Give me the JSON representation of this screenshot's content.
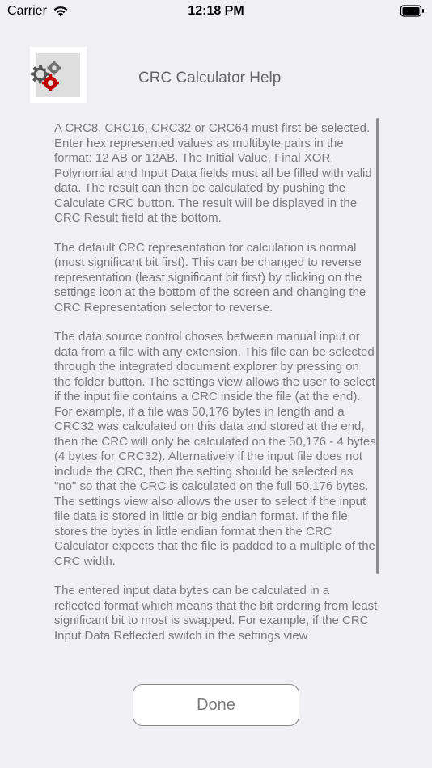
{
  "status_bar": {
    "carrier": "Carrier",
    "time": "12:18 PM",
    "icons": [
      "wifi-icon",
      "battery-icon"
    ]
  },
  "header": {
    "app_icon": "gears-icon",
    "title": "CRC Calculator Help"
  },
  "help": {
    "paragraphs": [
      "A CRC8, CRC16, CRC32 or CRC64 must first be selected. Enter hex represented values as multibyte pairs in the format: 12 AB or 12AB. The Initial Value, Final XOR, Polynomial and Input Data fields must all be filled with valid data. The result can then be calculated by pushing the Calculate CRC button. The result will be displayed in the CRC Result field at the bottom.",
      "The default CRC representation for calculation is normal (most significant bit first). This can be changed to reverse representation (least significant bit first) by clicking on the settings icon at the bottom of the screen and changing the CRC Representation selector to reverse.",
      "The data source control choses between manual input or data from a file with any extension. This file can be selected through the integrated document explorer by pressing on the folder button. The settings view allows the user to select if the input file contains a CRC inside the file (at the end). For example, if a file was 50,176 bytes in length and a CRC32 was calculated on this data and stored at the end, then the CRC will only be calculated on the 50,176 - 4 bytes (4 bytes for CRC32). Alternatively if the input file does not include the CRC, then the setting should be selected as \"no\" so that the CRC is calculated on the full 50,176 bytes. The settings view also allows the user to select if the input file data is stored in little or big endian format. If the file stores the bytes in little endian format then the CRC Calculator expects that the file is padded to a multiple of the CRC width.",
      "The entered input data bytes can be calculated in a reflected format which means that the bit ordering from least significant bit to most is swapped. For example, if the CRC Input Data Reflected switch in the settings view"
    ]
  },
  "done_button": {
    "label": "Done"
  }
}
